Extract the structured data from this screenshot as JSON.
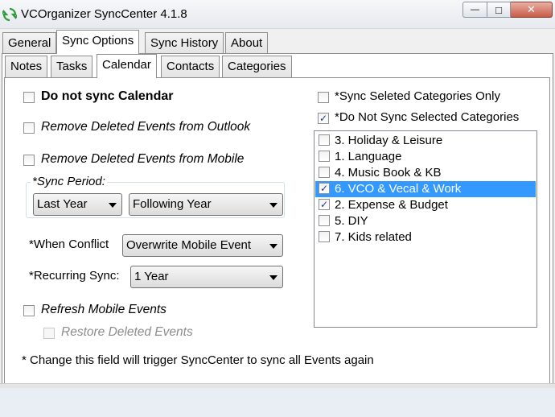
{
  "window": {
    "title": "VCOrganizer SyncCenter 4.1.8",
    "controls": {
      "minimize": "—",
      "maximize": "□",
      "close": "✕"
    }
  },
  "main_tabs": [
    {
      "label": "General",
      "active": false
    },
    {
      "label": "Sync Options",
      "active": true
    },
    {
      "label": "Sync History",
      "active": false
    },
    {
      "label": "About",
      "active": false
    }
  ],
  "sub_tabs": [
    {
      "label": "Notes",
      "active": false
    },
    {
      "label": "Tasks",
      "active": false
    },
    {
      "label": "Calendar",
      "active": true
    },
    {
      "label": "Contacts",
      "active": false
    },
    {
      "label": "Categories",
      "active": false
    }
  ],
  "calendar": {
    "do_not_sync": {
      "label": "Do not sync Calendar",
      "checked": false
    },
    "remove_from_outlook": {
      "label": "Remove Deleted Events from Outlook",
      "checked": false
    },
    "remove_from_mobile": {
      "label": "Remove Deleted Events from Mobile",
      "checked": false
    },
    "sync_period": {
      "title": "*Sync Period:",
      "start": "Last Year",
      "end": "Following Year"
    },
    "when_conflict": {
      "label": "*When Conflict",
      "value": "Overwrite Mobile Event"
    },
    "recurring_sync": {
      "label": "*Recurring Sync:",
      "value": "1 Year"
    },
    "refresh_mobile": {
      "label": "Refresh Mobile Events",
      "checked": false
    },
    "restore_deleted": {
      "label": "Restore Deleted Events",
      "checked": false,
      "disabled": true
    },
    "footnote": "* Change this field will trigger SyncCenter to sync all Events again"
  },
  "categories": {
    "sync_selected_only": {
      "label": "*Sync Seleted Categories Only",
      "checked": false
    },
    "do_not_sync_selected": {
      "label": "*Do Not Sync Selected Categories",
      "checked": true
    },
    "items": [
      {
        "label": "3. Holiday & Leisure",
        "checked": false,
        "selected": false
      },
      {
        "label": "1. Language",
        "checked": false,
        "selected": false
      },
      {
        "label": "4. Music Book & KB",
        "checked": false,
        "selected": false
      },
      {
        "label": "6. VCO & Vecal & Work",
        "checked": true,
        "selected": true
      },
      {
        "label": "2. Expense & Budget",
        "checked": true,
        "selected": false
      },
      {
        "label": "5. DIY",
        "checked": false,
        "selected": false
      },
      {
        "label": "7. Kids related",
        "checked": false,
        "selected": false
      }
    ]
  },
  "colors": {
    "selection": "#3399ff",
    "panel": "#ffffff",
    "chrome": "#f0f0f0"
  }
}
